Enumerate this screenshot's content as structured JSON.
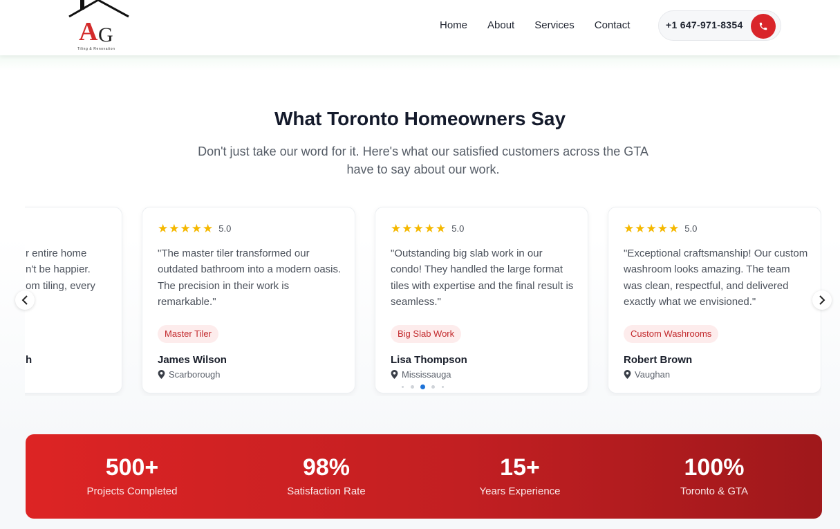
{
  "header": {
    "logo_letters": "AG",
    "logo_tagline": "Tiling & Renovation",
    "nav": [
      "Home",
      "About",
      "Services",
      "Contact"
    ],
    "phone": "+1 647-971-8354"
  },
  "colors": {
    "accent": "#d9252a",
    "star": "#f5b800",
    "tag_bg": "#fdecec"
  },
  "testimonials": {
    "title": "What Toronto Homeowners Say",
    "subtitle_line1": "Don't just take our word for it. Here's what our satisfied customers across the GTA",
    "subtitle_line2": "have to say about our work.",
    "partial_card": {
      "line1": "r entire home",
      "line2": "n't be happier.",
      "line3": "om tiling, every",
      "name_fragment": "h"
    },
    "cards": [
      {
        "rating": "5.0",
        "quote": "\"The master tiler transformed our outdated bathroom into a modern oasis. The precision in their work is remarkable.\"",
        "tag": "Master Tiler",
        "name": "James Wilson",
        "location": "Scarborough"
      },
      {
        "rating": "5.0",
        "quote": "\"Outstanding big slab work in our condo! They handled the large format tiles with expertise and the final result is seamless.\"",
        "tag": "Big Slab Work",
        "name": "Lisa Thompson",
        "location": "Mississauga"
      },
      {
        "rating": "5.0",
        "quote": "\"Exceptional craftsmanship! Our custom washroom looks amazing. The team was clean, respectful, and delivered exactly what we envisioned.\"",
        "tag": "Custom Washrooms",
        "name": "Robert Brown",
        "location": "Vaughan"
      }
    ],
    "active_dot_index": 2,
    "dot_count": 5
  },
  "stats": [
    {
      "value": "500+",
      "label": "Projects Completed"
    },
    {
      "value": "98%",
      "label": "Satisfaction Rate"
    },
    {
      "value": "15+",
      "label": "Years Experience"
    },
    {
      "value": "100%",
      "label": "Toronto & GTA"
    }
  ]
}
